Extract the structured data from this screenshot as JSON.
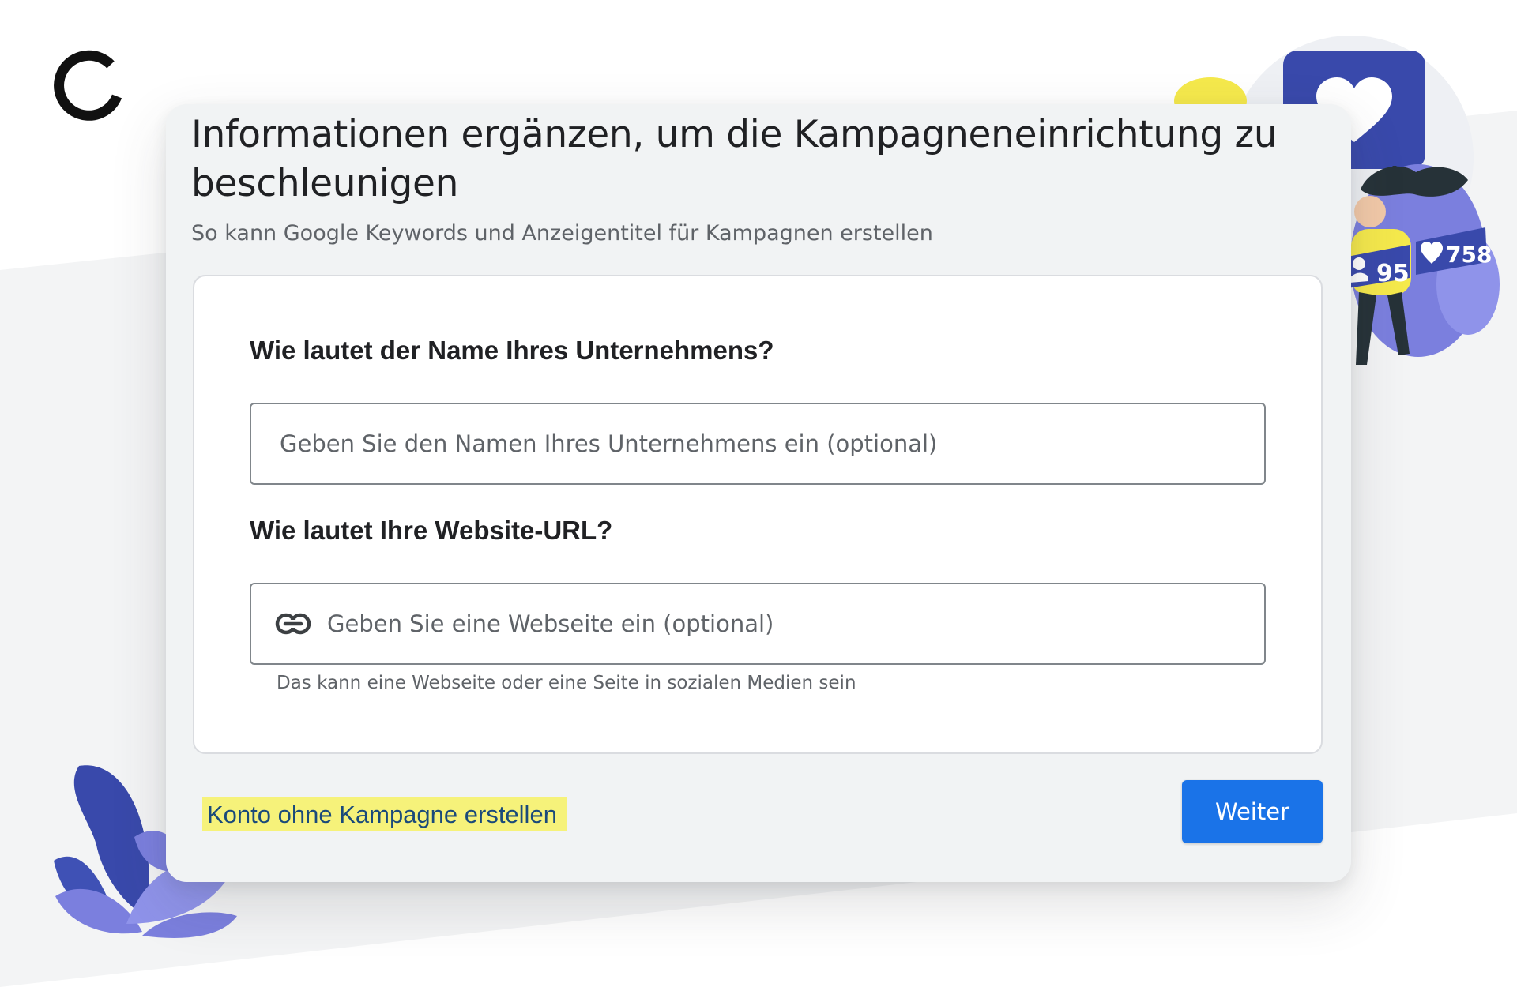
{
  "dialog": {
    "title": "Informationen ergänzen, um die Kampagneneinrichtung zu beschleunigen",
    "subtitle": "So kann Google Keywords und Anzeigentitel für Kampagnen erstellen"
  },
  "form": {
    "business_name": {
      "label": "Wie lautet der Name Ihres Unternehmens?",
      "placeholder": "Geben Sie den Namen Ihres Unternehmens ein (optional)",
      "value": ""
    },
    "website": {
      "label": "Wie lautet Ihre Website-URL?",
      "placeholder": "Geben Sie eine Webseite ein (optional)",
      "value": "",
      "helper": "Das kann eine Webseite oder eine Seite in sozialen Medien sein"
    }
  },
  "footer": {
    "skip_link": "Konto ohne Kampagne erstellen",
    "next_button": "Weiter"
  },
  "illustration": {
    "followers_count": "95",
    "likes_count": "758"
  },
  "colors": {
    "primary": "#1a73e8",
    "highlight": "#f6f27a",
    "illustration_blue": "#3949ab",
    "illustration_purple": "#7b7fde",
    "illustration_yellow": "#f5e94c"
  },
  "icons": {
    "logo": "spinner-arc-icon",
    "website_field": "link-icon"
  }
}
